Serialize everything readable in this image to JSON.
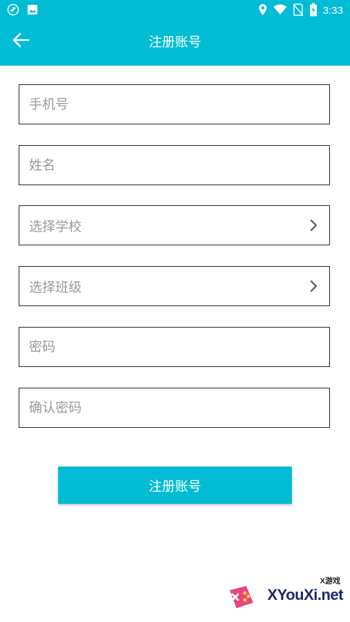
{
  "status_bar": {
    "time": "3:33",
    "left_icons": [
      "airplane-circle-icon",
      "image-icon"
    ],
    "right_icons": [
      "location-icon",
      "wifi-icon",
      "no-sim-icon",
      "battery-charging-icon"
    ]
  },
  "toolbar": {
    "title": "注册账号",
    "back_icon": "arrow-left-icon"
  },
  "form": {
    "phone": {
      "value": "",
      "placeholder": "手机号"
    },
    "name": {
      "value": "",
      "placeholder": "姓名"
    },
    "school": {
      "label": "选择学校",
      "icon": "chevron-right-icon"
    },
    "class": {
      "label": "选择班级",
      "icon": "chevron-right-icon"
    },
    "password": {
      "value": "",
      "placeholder": "密码"
    },
    "confirm_password": {
      "value": "",
      "placeholder": "确认密码"
    },
    "submit_label": "注册账号"
  },
  "watermark": {
    "small_text": "X游戏",
    "big_text": "XYouXi.net"
  },
  "colors": {
    "primary": "#00BCD4",
    "border": "#222222",
    "placeholder": "#9a9a9a",
    "background": "#ffffff"
  }
}
